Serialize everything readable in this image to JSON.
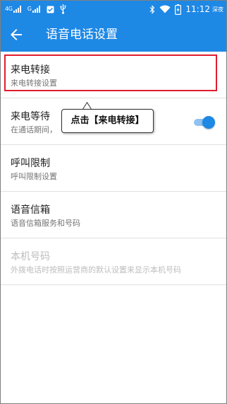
{
  "status_bar": {
    "network_1": "4G",
    "network_2": "G",
    "time": "11:12",
    "ampm": "深夜",
    "icons": [
      "signal-icon",
      "signal-icon",
      "notification-icon",
      "usb-icon",
      "bluetooth-icon",
      "wifi-icon",
      "battery-icon"
    ]
  },
  "app_bar": {
    "back_icon": "back-arrow-icon",
    "title": "语音电话设置"
  },
  "list": {
    "items": [
      {
        "title": "来电转接",
        "subtitle": "来电转接设置",
        "enabled": true
      },
      {
        "title": "来电等待",
        "subtitle": "在通话期间，",
        "enabled": true,
        "toggle_on": true
      },
      {
        "title": "呼叫限制",
        "subtitle": "呼叫限制设置",
        "enabled": true
      },
      {
        "title": "语音信箱",
        "subtitle": "语音信箱服务和号码",
        "enabled": true
      },
      {
        "title": "本机号码",
        "subtitle": "外拨电话时按照运营商的默认设置来显示本机号码",
        "enabled": false
      }
    ]
  },
  "callout": {
    "text": "点击【来电转接】"
  },
  "colors": {
    "accent": "#1e88e5",
    "highlight": "#e01d2f",
    "disabled_text": "#bdbdbd"
  }
}
